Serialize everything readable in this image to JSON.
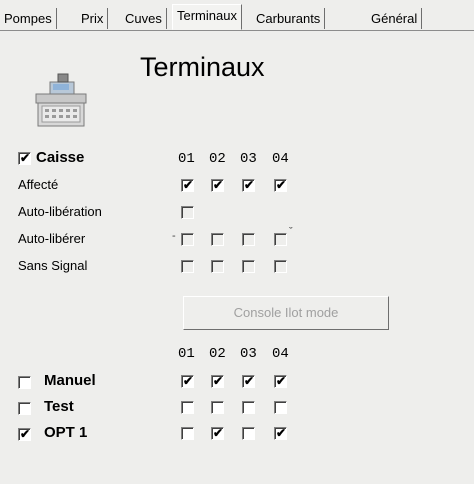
{
  "tabs": [
    {
      "label": "Pompes"
    },
    {
      "label": "Prix"
    },
    {
      "label": "Cuves"
    },
    {
      "label": "Terminaux",
      "active": true
    },
    {
      "label": "Carburants"
    },
    {
      "label": "Général"
    }
  ],
  "page_title": "Terminaux",
  "icon": "cash-register-icon",
  "caisse": {
    "label": "Caisse",
    "checked": true,
    "columns": [
      "01",
      "02",
      "03",
      "04"
    ],
    "rows": [
      {
        "label": "Affecté",
        "values": [
          true,
          true,
          true,
          true
        ]
      },
      {
        "label": "Auto-libération",
        "values": [
          false
        ]
      },
      {
        "label": "Auto-libérer",
        "values": [
          false,
          false,
          false,
          false
        ]
      },
      {
        "label": "Sans Signal",
        "values": [
          false,
          false,
          false,
          false
        ]
      }
    ]
  },
  "console_button": "Console Ilot mode",
  "options": {
    "columns": [
      "01",
      "02",
      "03",
      "04"
    ],
    "rows": [
      {
        "label": "Manuel",
        "checked": false,
        "values": [
          true,
          true,
          true,
          true
        ]
      },
      {
        "label": "Test",
        "checked": false,
        "values": [
          false,
          false,
          false,
          false
        ]
      },
      {
        "label": "OPT 1",
        "checked": true,
        "values": [
          false,
          true,
          false,
          true
        ]
      }
    ]
  }
}
